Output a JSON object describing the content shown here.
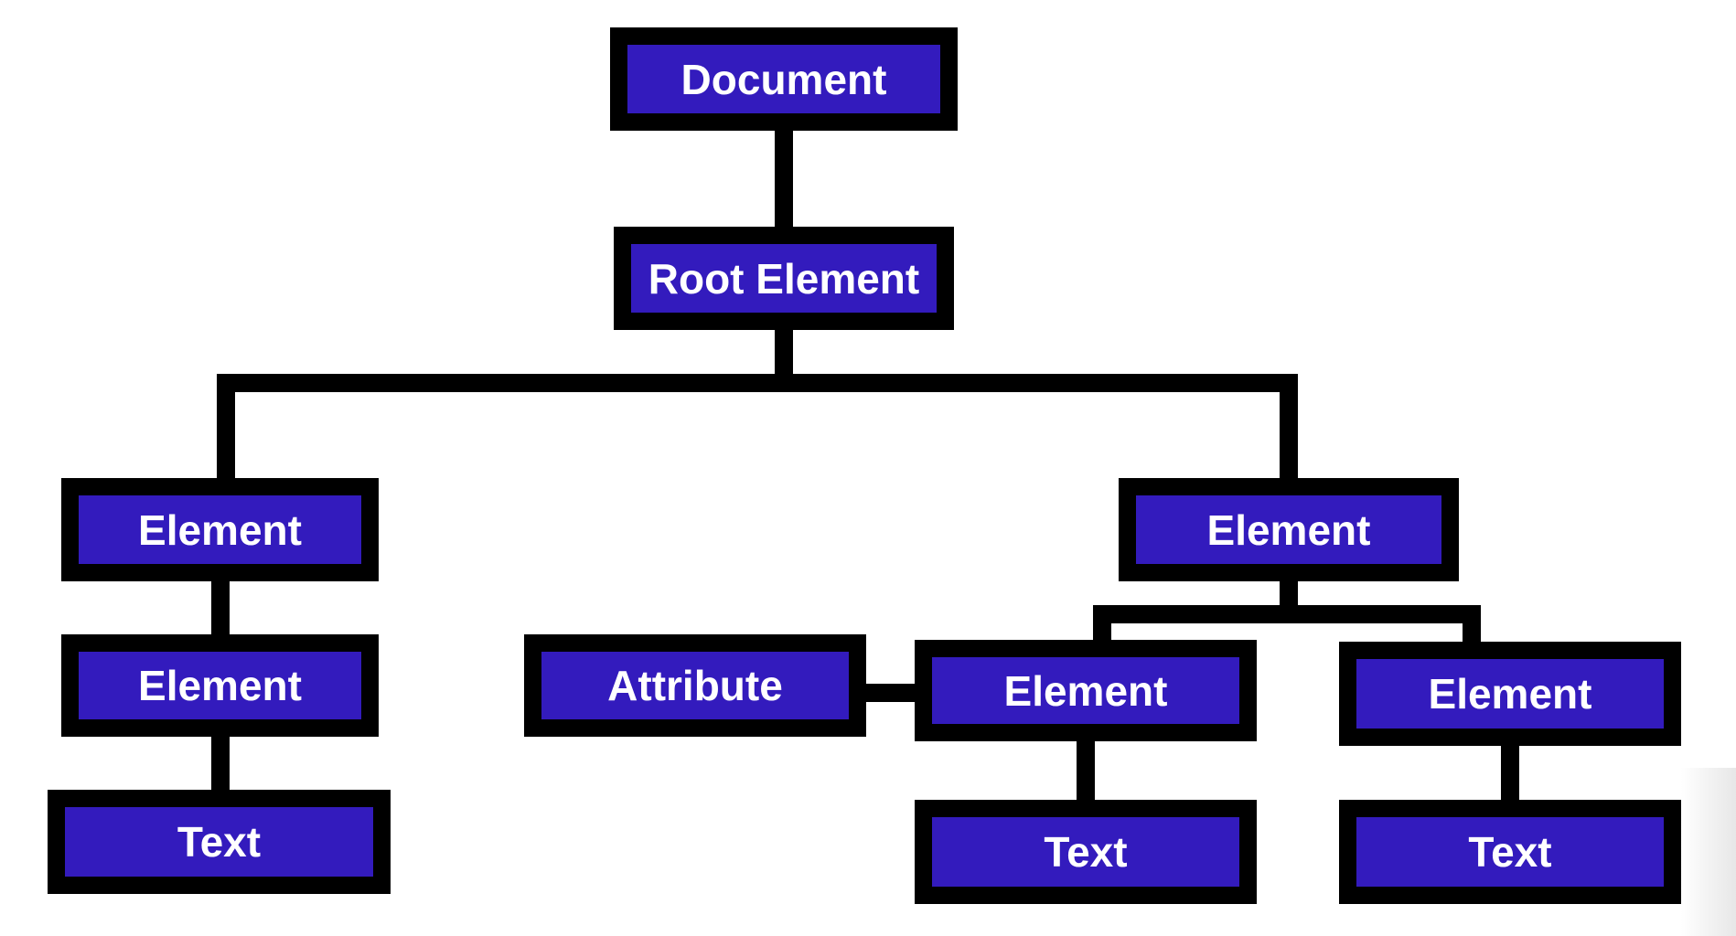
{
  "diagram": {
    "type": "tree",
    "title": "",
    "node_fill": "#331bbd",
    "border_color": "#000000",
    "text_color": "#ffffff",
    "nodes": [
      {
        "id": "document",
        "label": "Document"
      },
      {
        "id": "root",
        "label": "Root Element",
        "parent": "document"
      },
      {
        "id": "el_left",
        "label": "Element",
        "parent": "root"
      },
      {
        "id": "el_left_child",
        "label": "Element",
        "parent": "el_left"
      },
      {
        "id": "text_left",
        "label": "Text",
        "parent": "el_left_child"
      },
      {
        "id": "el_right",
        "label": "Element",
        "parent": "root"
      },
      {
        "id": "el_mid",
        "label": "Element",
        "parent": "el_right"
      },
      {
        "id": "attr",
        "label": "Attribute",
        "linked_to": "el_mid"
      },
      {
        "id": "text_mid",
        "label": "Text",
        "parent": "el_mid"
      },
      {
        "id": "el_far",
        "label": "Element",
        "parent": "el_right"
      },
      {
        "id": "text_far",
        "label": "Text",
        "parent": "el_far"
      }
    ]
  }
}
